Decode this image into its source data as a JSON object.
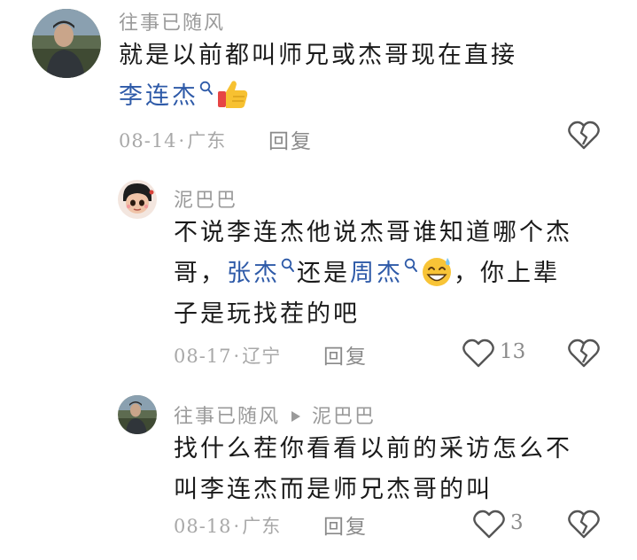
{
  "comments": [
    {
      "username": "往事已随风",
      "content_1": "就是以前都叫师兄或杰哥现在直接",
      "link_1": "李连杰",
      "date": "08-14",
      "location": "广东",
      "reply_label": "回复"
    },
    {
      "username": "泥巴巴",
      "line_1": "不说李连杰他说杰哥谁知道哪个杰",
      "line_2_a": "哥，",
      "link_1": "张杰",
      "line_2_b": "还是",
      "link_2": "周杰",
      "line_2_c": "，你上辈",
      "line_3": "子是玩找茬的吧",
      "date": "08-17",
      "location": "辽宁",
      "reply_label": "回复",
      "likes": "13"
    },
    {
      "username": "往事已随风",
      "reply_to": "泥巴巴",
      "line_1": "找什么茬你看看以前的采访怎么不",
      "line_2": "叫李连杰而是师兄杰哥的叫",
      "date": "08-18",
      "location": "广东",
      "reply_label": "回复",
      "likes": "3"
    }
  ],
  "separator": "·",
  "colors": {
    "link": "#2e5aa8",
    "meta": "#a8a8a8",
    "text": "#1a1a1a"
  }
}
